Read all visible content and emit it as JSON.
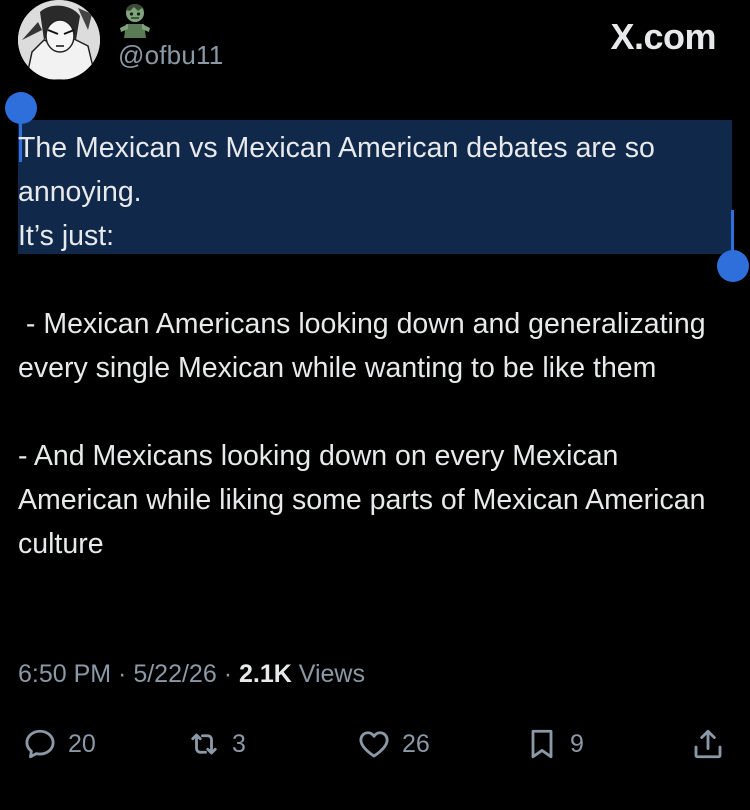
{
  "author": {
    "handle": "@ofbu11",
    "name_icon": "zombie-emoji"
  },
  "brand": "X.com",
  "tweet": {
    "lines": [
      "The Mexican vs Mexican American debates are so annoying.",
      "It’s just:",
      "",
      " - Mexican Americans looking down and generalizating every single Mexican while wanting to be like them",
      "",
      "- And Mexicans looking down on every Mexican American while liking some parts of Mexican American culture"
    ]
  },
  "meta": {
    "time": "6:50 PM",
    "sep1": " · ",
    "date": "5/22/26",
    "sep2": " · ",
    "views_count": "2.1K",
    "views_label": " Views"
  },
  "actions": {
    "reply_count": "20",
    "repost_count": "3",
    "like_count": "26",
    "bookmark_count": "9"
  },
  "colors": {
    "background": "#000000",
    "text": "#e7e9ea",
    "muted": "#8b98a5",
    "selection": "#10284a",
    "selection_handle": "#2f6fdb"
  }
}
